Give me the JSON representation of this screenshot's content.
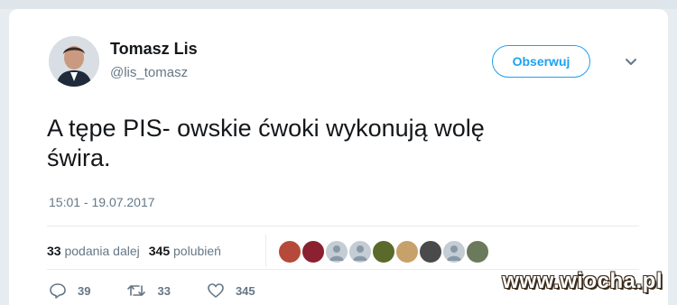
{
  "tweet": {
    "author_name": "Tomasz Lis",
    "author_handle": "@lis_tomasz",
    "follow_label": "Obserwuj",
    "text_line1": "A tępe PIS- owskie ćwoki wykonują wolę",
    "text_line2": "świra.",
    "timestamp": "15:01 - 19.07.2017"
  },
  "stats": {
    "retweets_count": "33",
    "retweets_label": "podania dalej",
    "likes_count": "345",
    "likes_label": "polubień"
  },
  "likers": [
    {
      "name": "liker-1",
      "color": "#b64a3a"
    },
    {
      "name": "liker-2",
      "color": "#8b2030"
    },
    {
      "name": "liker-3",
      "color": "#c4ccd4"
    },
    {
      "name": "liker-4",
      "color": "#c4ccd4"
    },
    {
      "name": "liker-5",
      "color": "#5a6a2a"
    },
    {
      "name": "liker-6",
      "color": "#c7a16a"
    },
    {
      "name": "liker-7",
      "color": "#4a4a4a"
    },
    {
      "name": "liker-8",
      "color": "#c4ccd4"
    },
    {
      "name": "liker-9",
      "color": "#6b7a5a"
    }
  ],
  "actions": {
    "replies": "39",
    "retweets": "33",
    "likes": "345"
  },
  "icons": {
    "reply": "reply-icon",
    "retweet": "retweet-icon",
    "like": "heart-icon",
    "menu": "chevron-down-icon"
  },
  "colors": {
    "accent": "#1da1f2",
    "secondary_text": "#657786",
    "primary_text": "#14171a"
  },
  "watermark": "www.wiocha.pl"
}
